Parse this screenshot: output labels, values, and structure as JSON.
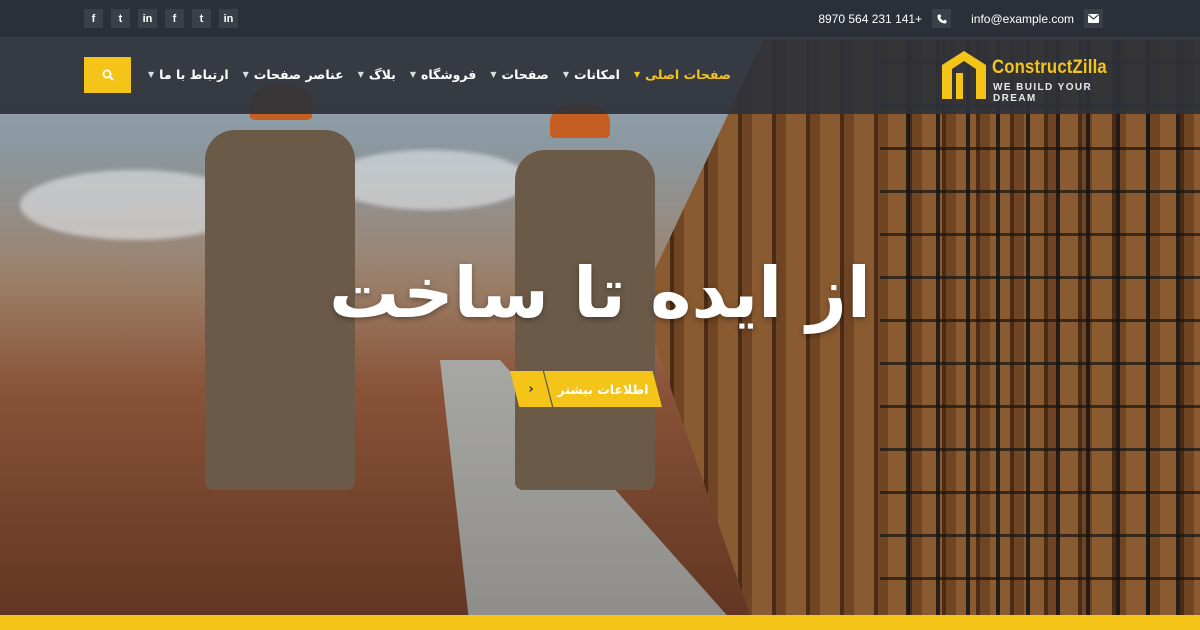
{
  "topbar": {
    "social": [
      {
        "icon": "facebook-icon",
        "glyph": "f"
      },
      {
        "icon": "twitter-icon",
        "glyph": "t"
      },
      {
        "icon": "linkedin-icon",
        "glyph": "in"
      },
      {
        "icon": "facebook-icon",
        "glyph": "f"
      },
      {
        "icon": "twitter-icon",
        "glyph": "t"
      },
      {
        "icon": "linkedin-icon",
        "glyph": "in"
      }
    ],
    "phone": "8970 564 231 141+",
    "email": "info@example.com"
  },
  "nav": {
    "menu": [
      {
        "label": "ارتباط با ما",
        "active": false
      },
      {
        "label": "عناصر صفحات",
        "active": false
      },
      {
        "label": "بلاگ",
        "active": false
      },
      {
        "label": "فروشگاه",
        "active": false
      },
      {
        "label": "صفحات",
        "active": false
      },
      {
        "label": "امکانات",
        "active": false
      },
      {
        "label": "صفحات اصلی",
        "active": true
      }
    ]
  },
  "logo": {
    "name": "ConstructZilla",
    "tagline": "WE BUILD YOUR DREAM"
  },
  "hero": {
    "headline": "از ایده تا ساخت",
    "cta_label": "اطلاعات بیشتر",
    "cta_arrow": "›"
  },
  "colors": {
    "accent": "#f5c418",
    "topbar": "#2b2f37",
    "navbar": "#2e323a"
  }
}
